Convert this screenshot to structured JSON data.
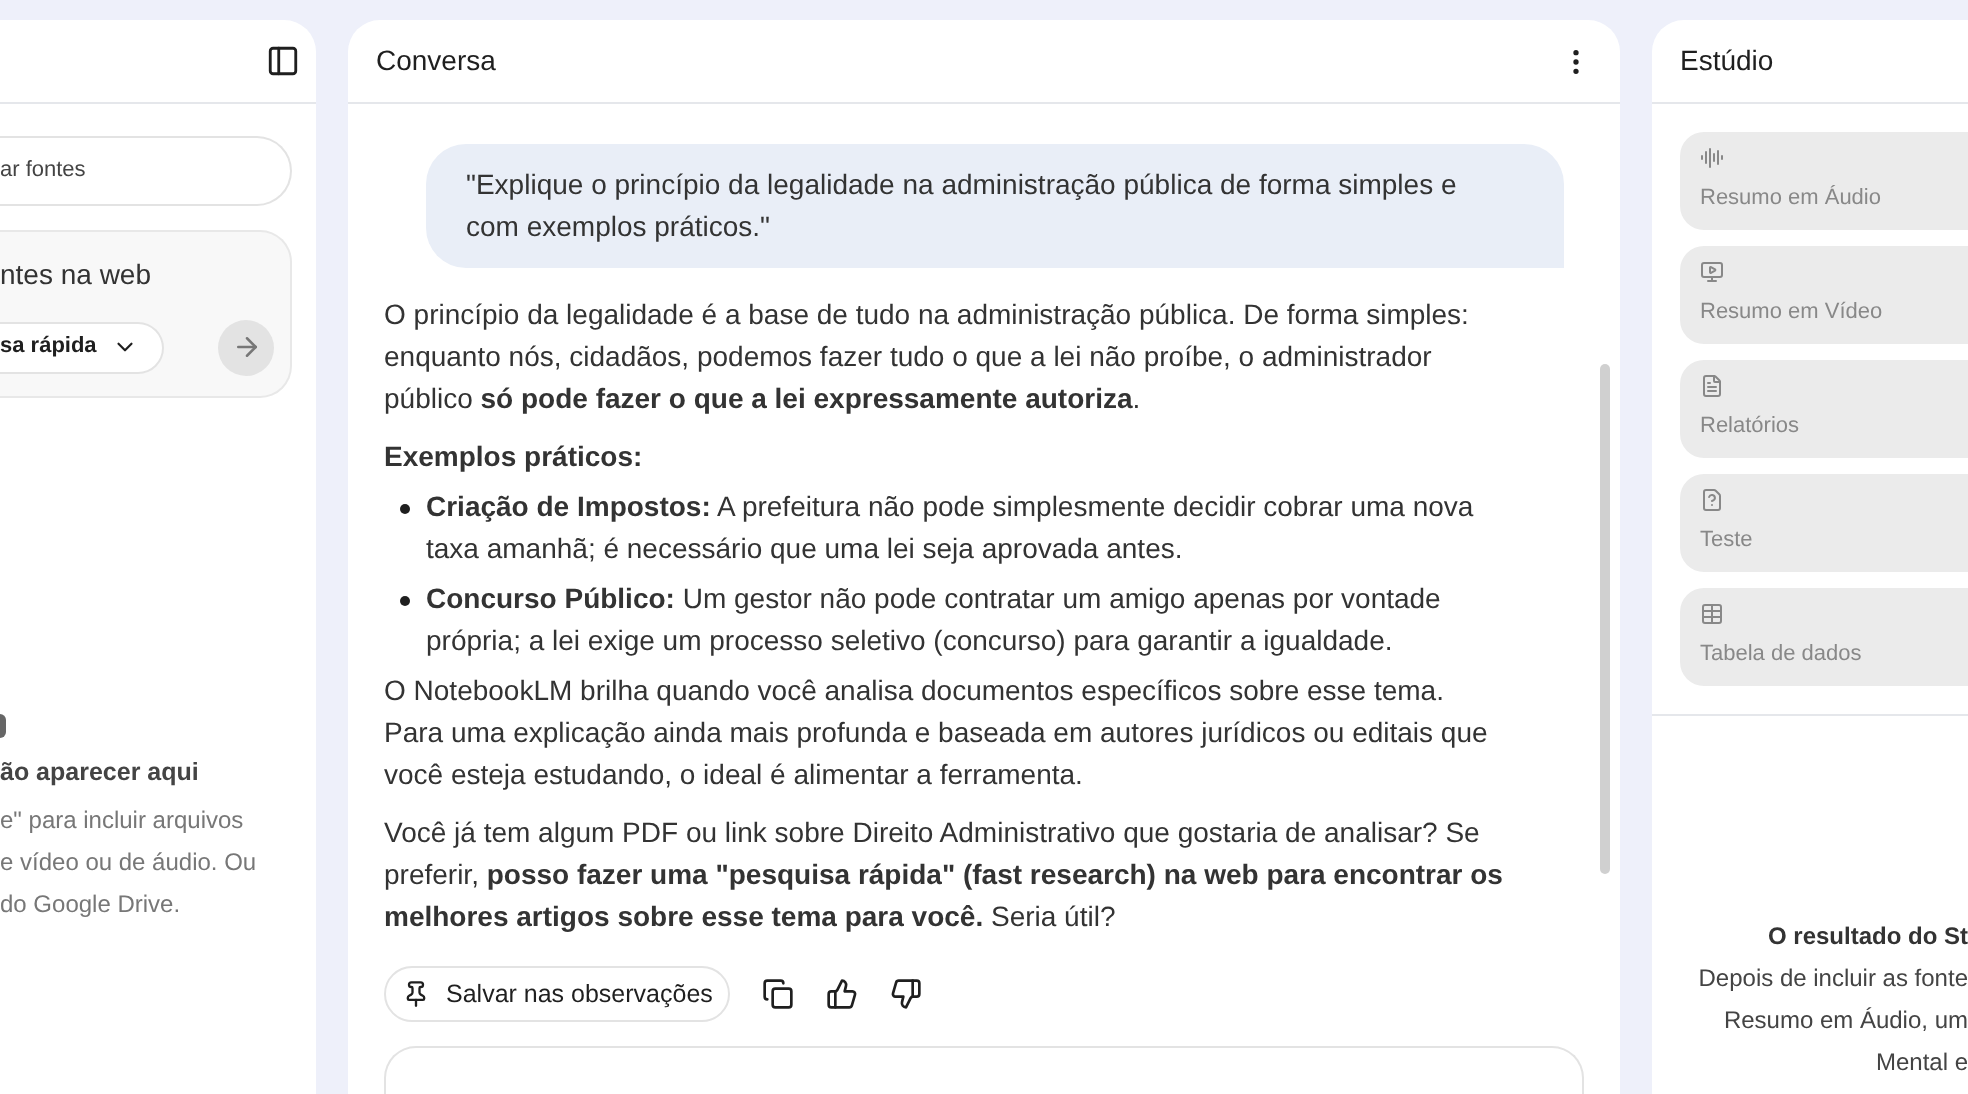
{
  "sources_panel": {
    "search": {
      "placeholder": "ar fontes"
    },
    "web_search": {
      "title": "ntes na web",
      "mode": "sa rápida"
    },
    "empty_state": {
      "title": "ão aparecer aqui",
      "lines": [
        "e\" para incluir arquivos",
        "e vídeo ou de áudio. Ou",
        "do Google Drive."
      ]
    }
  },
  "chat_panel": {
    "title": "Conversa",
    "user_message": "\"Explique o princípio da legalidade na administração pública de forma simples e com exemplos práticos.\"",
    "response": [
      {
        "kind": "paragraph",
        "text": "O princípio da legalidade é a base de tudo na administração pública. De forma simples: enquanto nós, cidadãos, podemos fazer tudo o que a lei não proíbe, o administrador público **só pode fazer o que a lei expressamente autoriza**."
      },
      {
        "kind": "heading",
        "text": "Exemplos práticos:"
      },
      {
        "kind": "bullet",
        "text": "**Criação de Impostos:** A prefeitura não pode simplesmente decidir cobrar uma nova taxa amanhã; é necessário que uma lei seja aprovada antes."
      },
      {
        "kind": "bullet",
        "text": "**Concurso Público:** Um gestor não pode contratar um amigo apenas por vontade própria; a lei exige um processo seletivo (concurso) para garantir a igualdade."
      },
      {
        "kind": "paragraph",
        "text": "O NotebookLM brilha quando você analisa documentos específicos sobre esse tema. Para uma explicação ainda mais profunda e baseada em autores jurídicos ou editais que você esteja estudando, o ideal é alimentar a ferramenta."
      },
      {
        "kind": "paragraph",
        "text": "Você já tem algum PDF ou link sobre Direito Administrativo que gostaria de analisar? Se preferir, **posso fazer uma \"pesquisa rápida\" (fast research) na web para encontrar os melhores artigos sobre esse tema para você.** Seria útil?"
      }
    ],
    "save_button": "Salvar nas observações"
  },
  "studio_panel": {
    "title": "Estúdio",
    "tools": [
      {
        "kind": "audio",
        "label": "Resumo em Áudio"
      },
      {
        "kind": "video",
        "label": "Resumo em Vídeo"
      },
      {
        "kind": "report",
        "label": "Relatórios"
      },
      {
        "kind": "quiz",
        "label": "Teste"
      },
      {
        "kind": "table",
        "label": "Tabela de dados"
      }
    ],
    "empty_state": {
      "title": "O resultado do St",
      "lines": [
        "Depois de incluir as fonte",
        "Resumo em Áudio, um",
        "Mental e"
      ]
    }
  }
}
